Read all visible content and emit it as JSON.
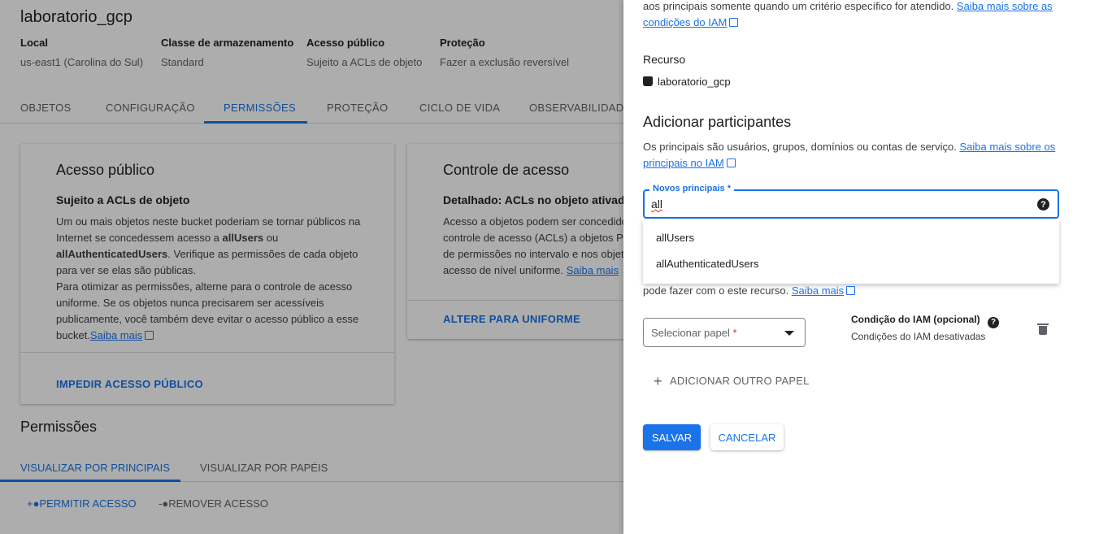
{
  "bucket": {
    "title": "laboratorio_gcp",
    "meta": [
      {
        "key": "Local",
        "value": "us-east1 (Carolina do Sul)"
      },
      {
        "key": "Classe de armazenamento",
        "value": "Standard"
      },
      {
        "key": "Acesso público",
        "value": "Sujeito a ACLs de objeto"
      },
      {
        "key": "Proteção",
        "value": "Fazer a exclusão reversível"
      }
    ]
  },
  "tabs": [
    "OBJETOS",
    "CONFIGURAÇÃO",
    "PERMISSÕES",
    "PROTEÇÃO",
    "CICLO DE VIDA",
    "OBSERVABILIDADE"
  ],
  "active_tab": "PERMISSÕES",
  "public_card": {
    "title": "Acesso público",
    "subtitle": "Sujeito a ACLs de objeto",
    "body_1": "Um ou mais objetos neste bucket poderiam se tornar públicos na Internet se concedessem acesso a ",
    "body_b1": "allUsers",
    "body_2": " ou ",
    "body_b2": "allAuthenticatedUsers",
    "body_3": ". Verifique as permissões de cada objeto para ver se elas são públicas.",
    "body_4": "Para otimizar as permissões, alterne para o controle de acesso uniforme. Se os objetos nunca precisarem ser acessíveis publicamente, você também deve evitar o acesso público a esse bucket.",
    "link": "Saiba mais",
    "action": "IMPEDIR ACESSO PÚBLICO"
  },
  "access_card": {
    "title": "Controle de acesso",
    "subtitle": "Detalhado: ACLs no objeto ativad",
    "body": "Acesso a objetos podem ser concedido controle de acesso (ACLs) a objetos Pa de permissões no intervalo e nos objet acesso de nível uniforme.",
    "link": "Saiba mais",
    "action": "ALTERE PARA UNIFORME"
  },
  "permissions": {
    "title": "Permissões",
    "tabs": [
      "VISUALIZAR POR PRINCIPAIS",
      "VISUALIZAR POR PAPÉIS"
    ],
    "grant": "PERMITIR ACESSO",
    "remove": "REMOVER ACESSO"
  },
  "panel": {
    "intro_text": "aos principais somente quando um critério específico for atendido.",
    "intro_link_1": "Saiba mais sobre as",
    "intro_link_2": "condições do IAM",
    "resource_label": "Recurso",
    "resource_name": "laboratorio_gcp",
    "add_title": "Adicionar participantes",
    "add_text": "Os principais são usuários, grupos, domínios ou contas de serviço.",
    "add_link_1": "Saiba mais sobre os",
    "add_link_2": "principais no IAM",
    "field_label": "Novos principais *",
    "field_value": "all",
    "suggestions": [
      "allUsers",
      "allAuthenticatedUsers"
    ],
    "role_text": "pode fazer com o este recurso.",
    "role_link": "Saiba mais",
    "select_placeholder": "Selecionar papel",
    "select_required": "*",
    "iam_condition_title": "Condição do IAM (opcional)",
    "iam_condition_status": "Condições do IAM desativadas",
    "add_role": "ADICIONAR OUTRO PAPEL",
    "save": "SALVAR",
    "cancel": "CANCELAR"
  },
  "colors": {
    "accent": "#1a73e8",
    "error": "#d93025",
    "scrim": "rgba(0,0,0,0.32)"
  }
}
